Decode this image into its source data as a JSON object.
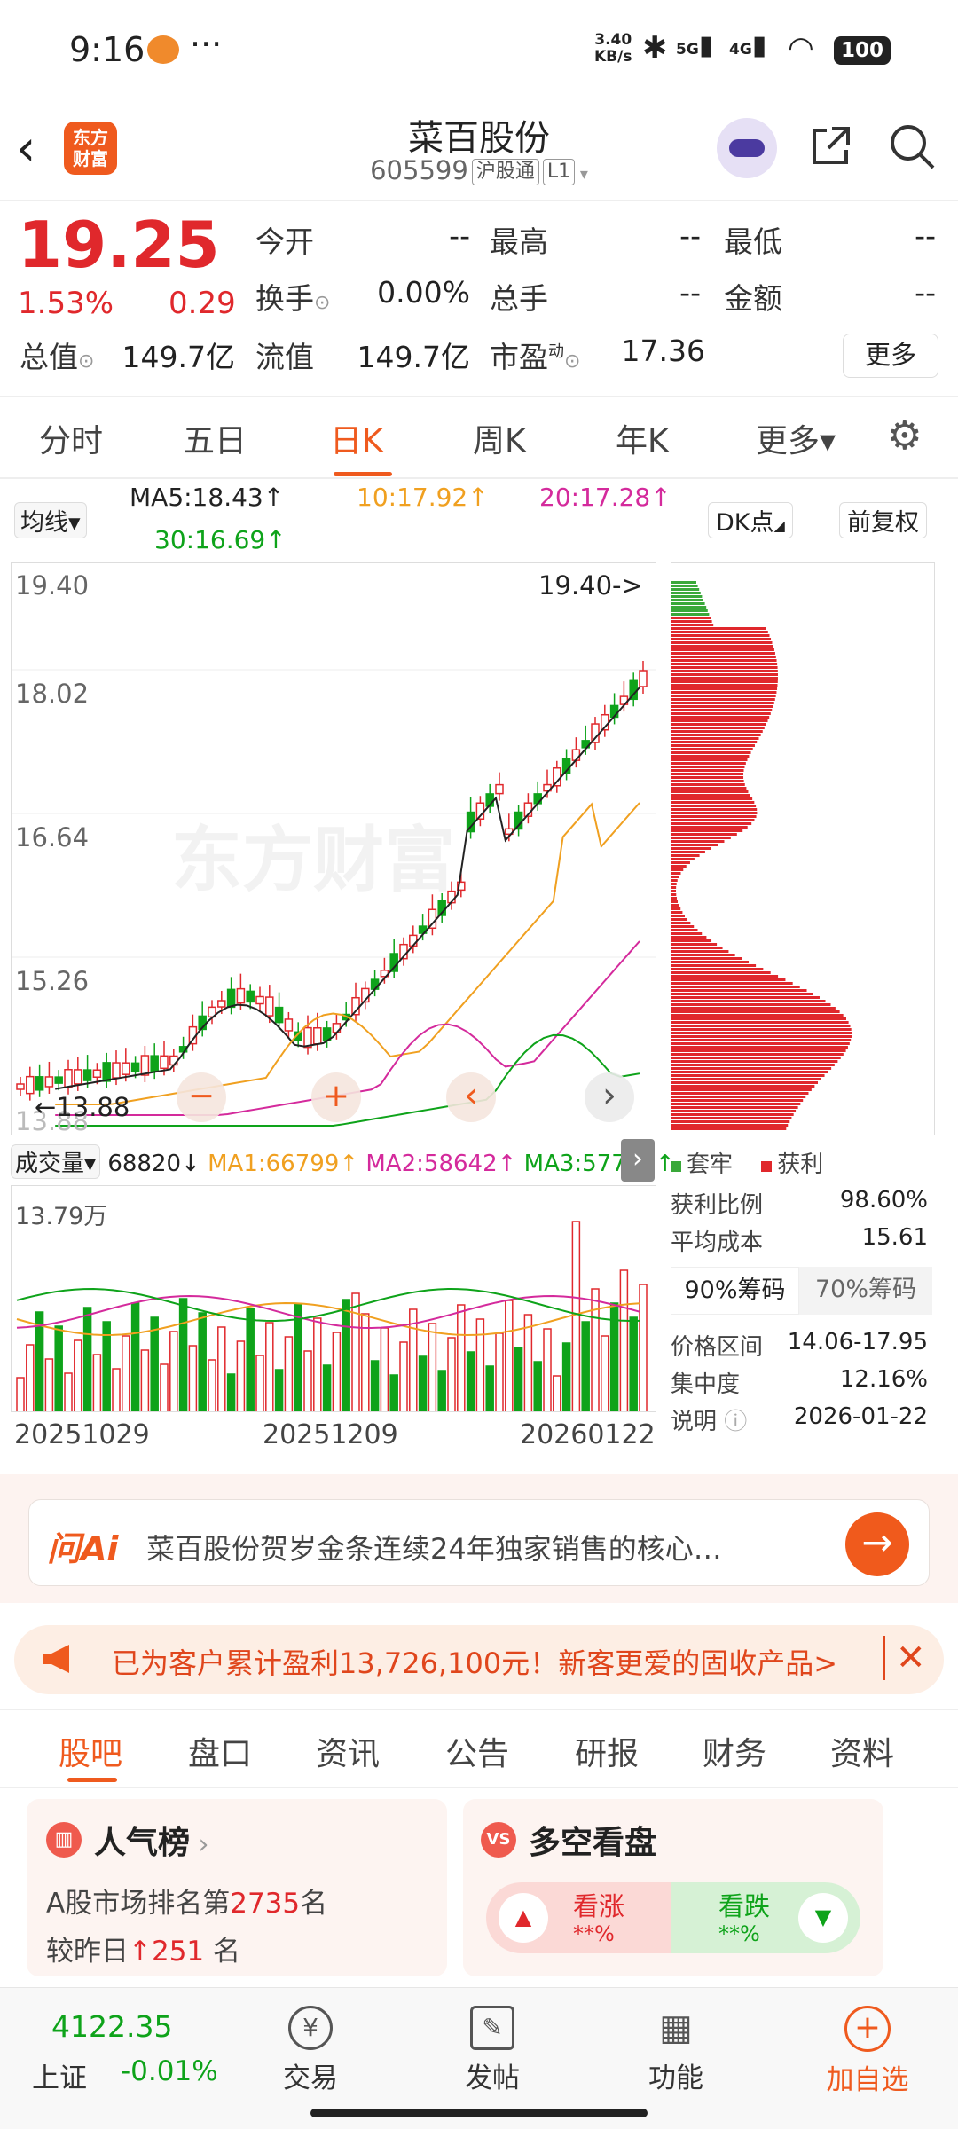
{
  "status": {
    "time": "9:16",
    "speed_top": "3.40",
    "speed_bottom": "KB/s",
    "net_5g": "5G",
    "net_4g": "4G",
    "battery": "100"
  },
  "header": {
    "name": "菜百股份",
    "code": "605599",
    "tag1": "沪股通",
    "tag2": "L1",
    "logo_line1": "东方",
    "logo_line2": "财富"
  },
  "quote": {
    "price": "19.25",
    "pct": "1.53%",
    "chg": "0.29",
    "open_label": "今开",
    "open": "--",
    "high_label": "最高",
    "high": "--",
    "low_label": "最低",
    "low": "--",
    "turnover_label": "换手",
    "turnover": "0.00%",
    "vol_label": "总手",
    "vol": "--",
    "amount_label": "金额",
    "amount": "--",
    "mcap_label": "总值",
    "mcap": "149.7亿",
    "float_label": "流值",
    "float": "149.7亿",
    "pe_label": "市盈",
    "pe_sup": "动",
    "pe": "17.36",
    "more": "更多"
  },
  "chart_tabs": [
    "分时",
    "五日",
    "日K",
    "周K",
    "年K",
    "更多▾"
  ],
  "ma_bar": {
    "selector": "均线▾",
    "ma5": "MA5:18.43↑",
    "ma10": "10:17.92↑",
    "ma20": "20:17.28↑",
    "ma30": "30:16.69↑",
    "dk": "DK点",
    "fq": "前复权"
  },
  "kchart": {
    "y_labels": [
      "19.40",
      "18.02",
      "16.64",
      "15.26",
      "13.88"
    ],
    "high_mark": "19.40->",
    "low_mark": "←13.88",
    "watermark": "东方财富",
    "btns": [
      "−",
      "+",
      "‹",
      "›"
    ]
  },
  "vol_bar": {
    "selector": "成交量▾",
    "vol": "68820↓",
    "ma1": "MA1:66799↑",
    "ma2": "MA2:58642↑",
    "ma3": "MA3:57731↑",
    "ymax": "13.79万",
    "dates": [
      "20251029",
      "20251209",
      "20260122"
    ]
  },
  "chip": {
    "legend_trapped": "套牢",
    "legend_profit": "获利",
    "rows": [
      {
        "k": "获利比例",
        "v": "98.60%"
      },
      {
        "k": "平均成本",
        "v": "15.61"
      }
    ],
    "tab90": "90%筹码",
    "tab70": "70%筹码",
    "rows2": [
      {
        "k": "价格区间",
        "v": "14.06-17.95"
      },
      {
        "k": "集中度",
        "v": "12.16%"
      },
      {
        "k": "说明",
        "v": "2026-01-22"
      }
    ]
  },
  "ai": {
    "logo": "问Ai",
    "text": "菜百股份贺岁金条连续24年独家销售的核心…"
  },
  "promo": {
    "text": "已为客户累计盈利13,726,100元！新客更爱的固收产品>"
  },
  "bottom_tabs": [
    "股吧",
    "盘口",
    "资讯",
    "公告",
    "研报",
    "财务",
    "资料"
  ],
  "card1": {
    "title": "人气榜",
    "line1a": "A股市场排名第",
    "rank": "2735",
    "line1b": "名",
    "line2a": "较昨日",
    "delta": "251",
    "line2b": "名"
  },
  "card2": {
    "title": "多空看盘",
    "up": "看涨",
    "up_pct": "**%",
    "down": "看跌",
    "down_pct": "**%"
  },
  "nav": {
    "index_val": "4122.35",
    "index_name": "上证",
    "index_chg": "-0.01%",
    "trade": "交易",
    "post": "发帖",
    "func": "功能",
    "add": "加自选"
  },
  "colors": {
    "up": "#e0282c",
    "down": "#0ea31a",
    "accent": "#ef5a1e"
  }
}
